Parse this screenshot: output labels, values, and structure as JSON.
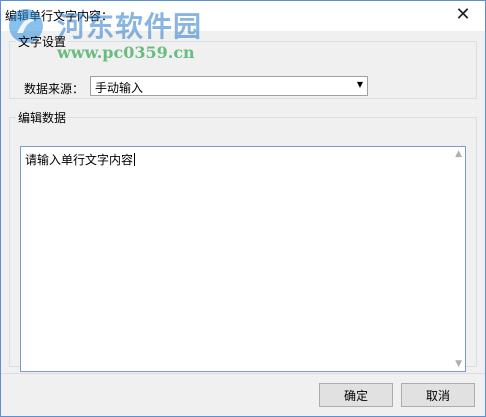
{
  "window": {
    "title": "编辑单行文字内容：",
    "close_symbol": "✕"
  },
  "watermark": {
    "name": "河东软件园",
    "url": "www.pc0359.cn"
  },
  "text_settings": {
    "legend": "文字设置",
    "source_label": "数据来源：",
    "source_value": "手动输入"
  },
  "edit_data": {
    "legend": "编辑数据",
    "content": "请输入单行文字内容"
  },
  "buttons": {
    "ok": "确定",
    "cancel": "取消"
  },
  "icons": {
    "close": "close-icon",
    "dropdown": "chevron-down-icon",
    "scroll_up": "scroll-up-arrow-icon",
    "scroll_down": "scroll-down-arrow-icon"
  }
}
